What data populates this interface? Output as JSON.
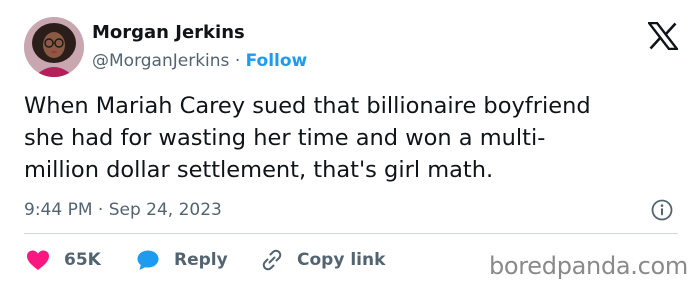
{
  "author": {
    "name": "Morgan Jerkins",
    "handle": "@MorganJerkins",
    "separator": "·",
    "follow_label": "Follow"
  },
  "tweet": {
    "text_lines": [
      "When Mariah Carey sued that billionaire boyfriend",
      "she had for wasting her time and won a multi-",
      "million dollar settlement, that's girl math."
    ],
    "timestamp": "9:44 PM · Sep 24, 2023"
  },
  "actions": {
    "like_count": "65K",
    "reply_label": "Reply",
    "copy_link_label": "Copy link"
  },
  "icons": {
    "platform": "x-logo-icon",
    "info": "info-icon",
    "like": "heart-icon",
    "reply": "speech-bubble-icon",
    "copy": "link-icon"
  },
  "colors": {
    "follow": "#1d9bf0",
    "like": "#f91880",
    "reply": "#1d9bf0",
    "secondary_text": "#536471"
  },
  "watermark": "boredpanda.com"
}
